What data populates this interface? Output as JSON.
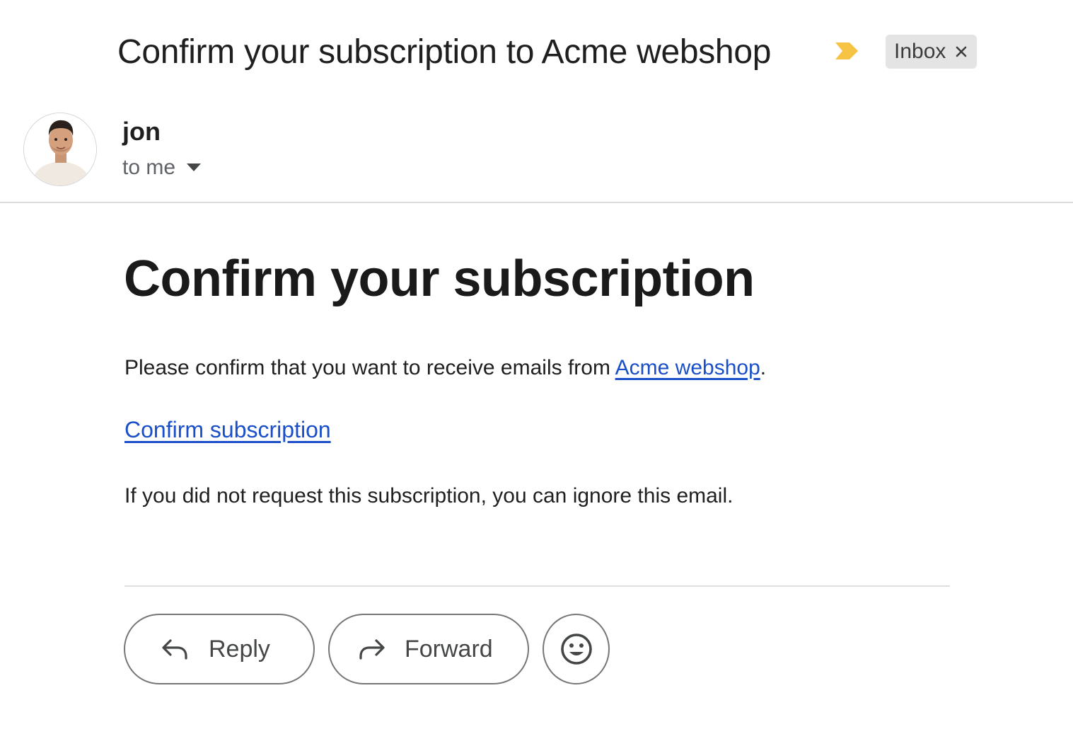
{
  "email": {
    "subject": "Confirm your subscription to Acme webshop",
    "label": "Inbox",
    "importance_color": "#f6c344"
  },
  "sender": {
    "name": "jon",
    "recipient": "to me"
  },
  "body": {
    "heading": "Confirm your subscription",
    "para1_prefix": "Please confirm that you want to receive emails from ",
    "para1_link": "Acme webshop",
    "para1_suffix": ".",
    "confirm_link": "Confirm subscription",
    "para3": "If you did not request this subscription, you can ignore this email.",
    "link_color": "#1a4fc9"
  },
  "actions": {
    "reply_label": "Reply",
    "forward_label": "Forward"
  },
  "icons": {
    "importance": "importance-marker-icon",
    "label_close": "close-icon",
    "recipient_caret": "caret-down-icon",
    "reply": "reply-arrow-icon",
    "forward": "forward-arrow-icon",
    "emoji": "smiley-icon",
    "avatar": "avatar"
  }
}
